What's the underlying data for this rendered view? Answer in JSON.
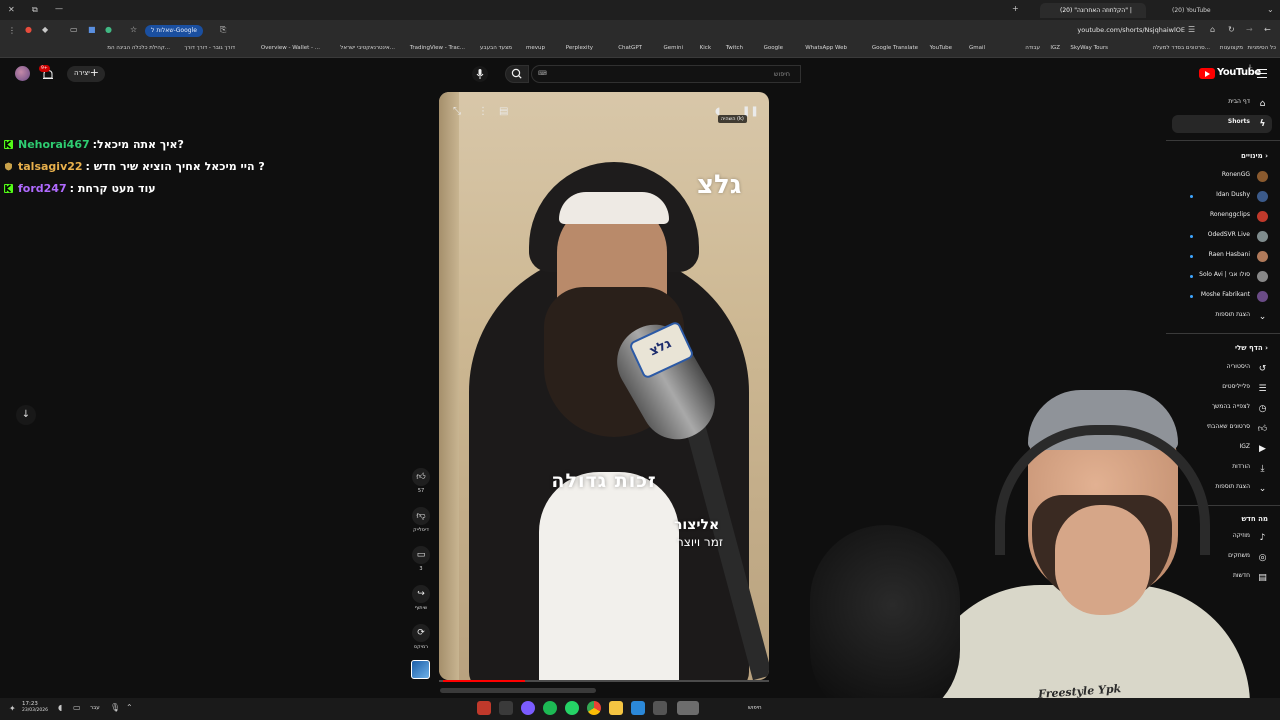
{
  "browser": {
    "tabs": [
      {
        "title": "(20) YouTube"
      },
      {
        "title": "(20) \"הקלחוזה האחרונה\" |"
      }
    ],
    "url": "youtube.com/shorts/NsjqhaiwlOE",
    "google_pill": "שאלות ל-Google",
    "bookmarks": [
      "כל הסימניות",
      "מקצוענות",
      "סרטונים בסדר למעלה...",
      "SkyWay Tours",
      "IGZ",
      "עבודה",
      "Gmail",
      "YouTube",
      "Google Translate",
      "WhatsApp Web",
      "Google",
      "Twitch",
      "Kick",
      "Gemini",
      "ChatGPT",
      "Perplexity",
      "mevup",
      "מצעד הבעבע",
      "TradingView - Trac...",
      "אינטרנאקטיבי ישראל...",
      "Overview - Wallet - ...",
      "דורך גובר - דורך דורך",
      "קהילת כלכלה הבינה המ..."
    ]
  },
  "header": {
    "logo_text": "YouTube",
    "logo_country": "IL",
    "search_placeholder": "חיפוש",
    "search_kbd": "⌨",
    "create_label": "יצירה",
    "notif_count": "9+"
  },
  "chat": [
    {
      "user": "Nehorai467",
      "message": ":איך אתה מיכאל?",
      "color": "#2ecc71",
      "badge": "kick"
    },
    {
      "user": "talsagiv22",
      "message": ": היי מיכאל אחיך הוציא שיר חדש ?",
      "color": "#e8b04c",
      "badge": "shield"
    },
    {
      "user": "ford247",
      "message": ": עוד מעט קרחת",
      "color": "#b06aff",
      "badge": "kick"
    }
  ],
  "video": {
    "brand_overlay": "גלצ",
    "mic_flag": "גלצ",
    "caption": "זכות גדולה",
    "credit_line1": "אליצור",
    "credit_line2": "זמר ויוצר",
    "tooltip": "השהיה (k)",
    "progress": 0.25
  },
  "actions": {
    "like_count": "57",
    "dislike_label": "דיסלייק",
    "comments_count": "3",
    "share_label": "שיתוף",
    "remix_label": "רמיקס"
  },
  "sidebar": {
    "home": "דף הבית",
    "shorts": "Shorts",
    "subscriptions_header": "מינויים",
    "subscriptions": [
      {
        "name": "RonenGG",
        "color": "#8a5a2e"
      },
      {
        "name": "Idan Dushy",
        "color": "#3b5a8a",
        "live": true
      },
      {
        "name": "Ronenggclips",
        "color": "#c0392b"
      },
      {
        "name": "OdedSVR Live",
        "color": "#7f8c8d",
        "live": true
      },
      {
        "name": "Raen Hasbani",
        "color": "#b07a5a",
        "live": true
      },
      {
        "name": "Solo Avi | סולו אבי",
        "color": "#888888",
        "live": true
      },
      {
        "name": "Moshe Fabrikant",
        "color": "#6a4b86",
        "live": true
      }
    ],
    "more_label": "הצגת תוספות",
    "you_header": "הדף שלי",
    "you_items": [
      "היסטוריה",
      "פלייליסטים",
      "לצפייה בהמשך",
      "סרטונים שאהבתי",
      "IGZ",
      "הורדות"
    ],
    "more_label2": "הצגת תוספות",
    "explore_header": "מה חדש",
    "explore_items": [
      "מוזיקה",
      "משחקים",
      "חדשות"
    ]
  },
  "webcam": {
    "shirt_text": "Freestyle Ypk"
  },
  "taskbar": {
    "time": "17:23",
    "date": "23/03/2026",
    "lang": "עבר",
    "search": "חיפוש"
  }
}
